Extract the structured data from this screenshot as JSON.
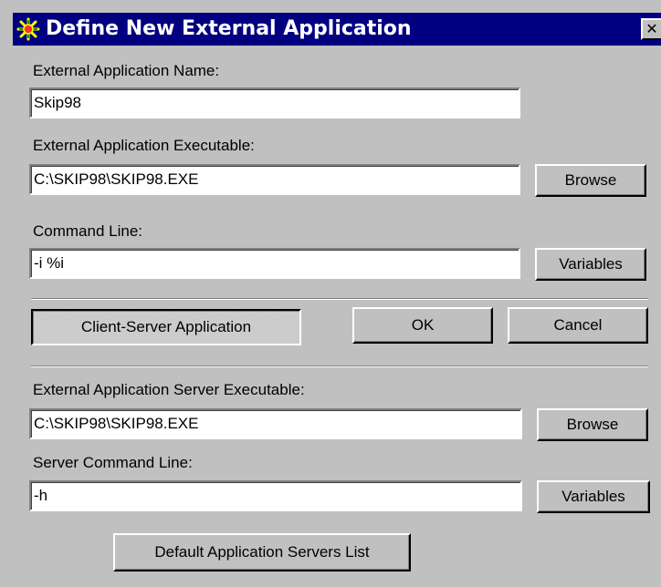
{
  "window": {
    "title": "Define New External Application",
    "close_label": "✕"
  },
  "app_name": {
    "label": "External Application Name:",
    "value": "Skip98"
  },
  "app_executable": {
    "label": "External Application Executable:",
    "value": "C:\\SKIP98\\SKIP98.EXE",
    "browse_label": "Browse"
  },
  "command_line": {
    "label": "Command Line:",
    "value": "-i %i",
    "variables_label": "Variables"
  },
  "actions": {
    "client_server_label": "Client-Server Application",
    "client_server_pressed": true,
    "ok_label": "OK",
    "cancel_label": "Cancel"
  },
  "server_executable": {
    "label": "External Application Server Executable:",
    "value": "C:\\SKIP98\\SKIP98.EXE",
    "browse_label": "Browse"
  },
  "server_command_line": {
    "label": "Server Command Line:",
    "value": "-h",
    "variables_label": "Variables"
  },
  "default_servers": {
    "label": "Default Application Servers List"
  },
  "colors": {
    "titlebar": "#000080",
    "face": "#c0c0c0",
    "field": "#ffffff"
  },
  "icons": {
    "title": "app-gear-icon",
    "close": "close-icon"
  }
}
